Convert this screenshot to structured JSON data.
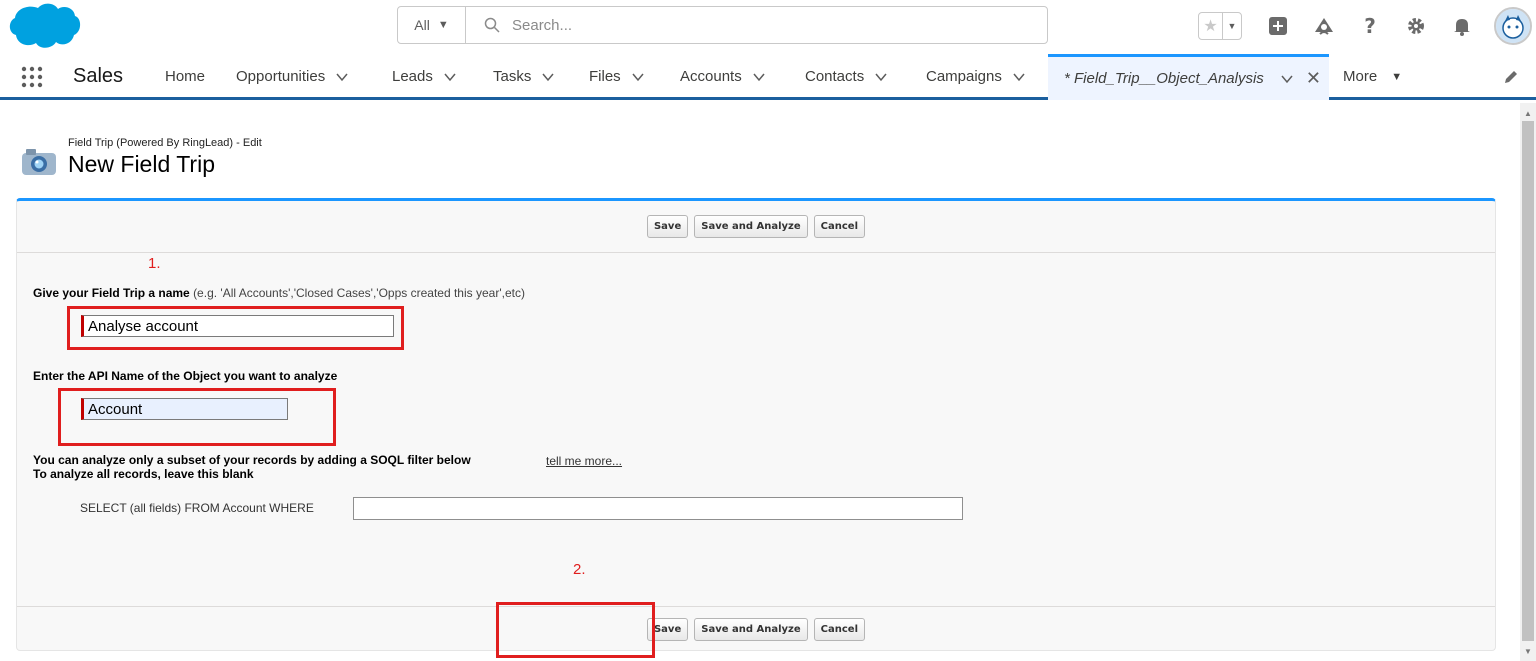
{
  "header": {
    "search_scope": "All",
    "search_placeholder": "Search..."
  },
  "nav": {
    "app_name": "Sales",
    "items": [
      {
        "label": "Home",
        "has_menu": false
      },
      {
        "label": "Opportunities",
        "has_menu": true
      },
      {
        "label": "Leads",
        "has_menu": true
      },
      {
        "label": "Tasks",
        "has_menu": true
      },
      {
        "label": "Files",
        "has_menu": true
      },
      {
        "label": "Accounts",
        "has_menu": true
      },
      {
        "label": "Contacts",
        "has_menu": true
      },
      {
        "label": "Campaigns",
        "has_menu": true
      }
    ],
    "active_tab": "* Field_Trip__Object_Analysis",
    "more_label": "More"
  },
  "page": {
    "subtitle": "Field Trip (Powered By RingLead) - Edit",
    "title": "New Field Trip"
  },
  "buttons": {
    "save": "Save",
    "save_analyze": "Save and Analyze",
    "cancel": "Cancel"
  },
  "annotations": {
    "step1": "1.",
    "step2": "2."
  },
  "form": {
    "name_label": "Give your Field Trip a name",
    "name_hint": "(e.g. 'All Accounts','Closed Cases','Opps created this year',etc)",
    "name_value": "Analyse account",
    "api_label": "Enter the API Name of the Object you want to analyze",
    "api_value": "Account",
    "filter_line1": "You can analyze only a subset of your records by adding a SOQL filter below",
    "filter_line2": "To analyze all records, leave this blank",
    "tell_me_more": "tell me more...",
    "soql_prefix": "SELECT (all fields) FROM Account WHERE",
    "soql_value": ""
  },
  "colors": {
    "brand_blue": "#1b96ff",
    "nav_border": "#1b5f9e",
    "annotation_red": "#e01e1e"
  }
}
